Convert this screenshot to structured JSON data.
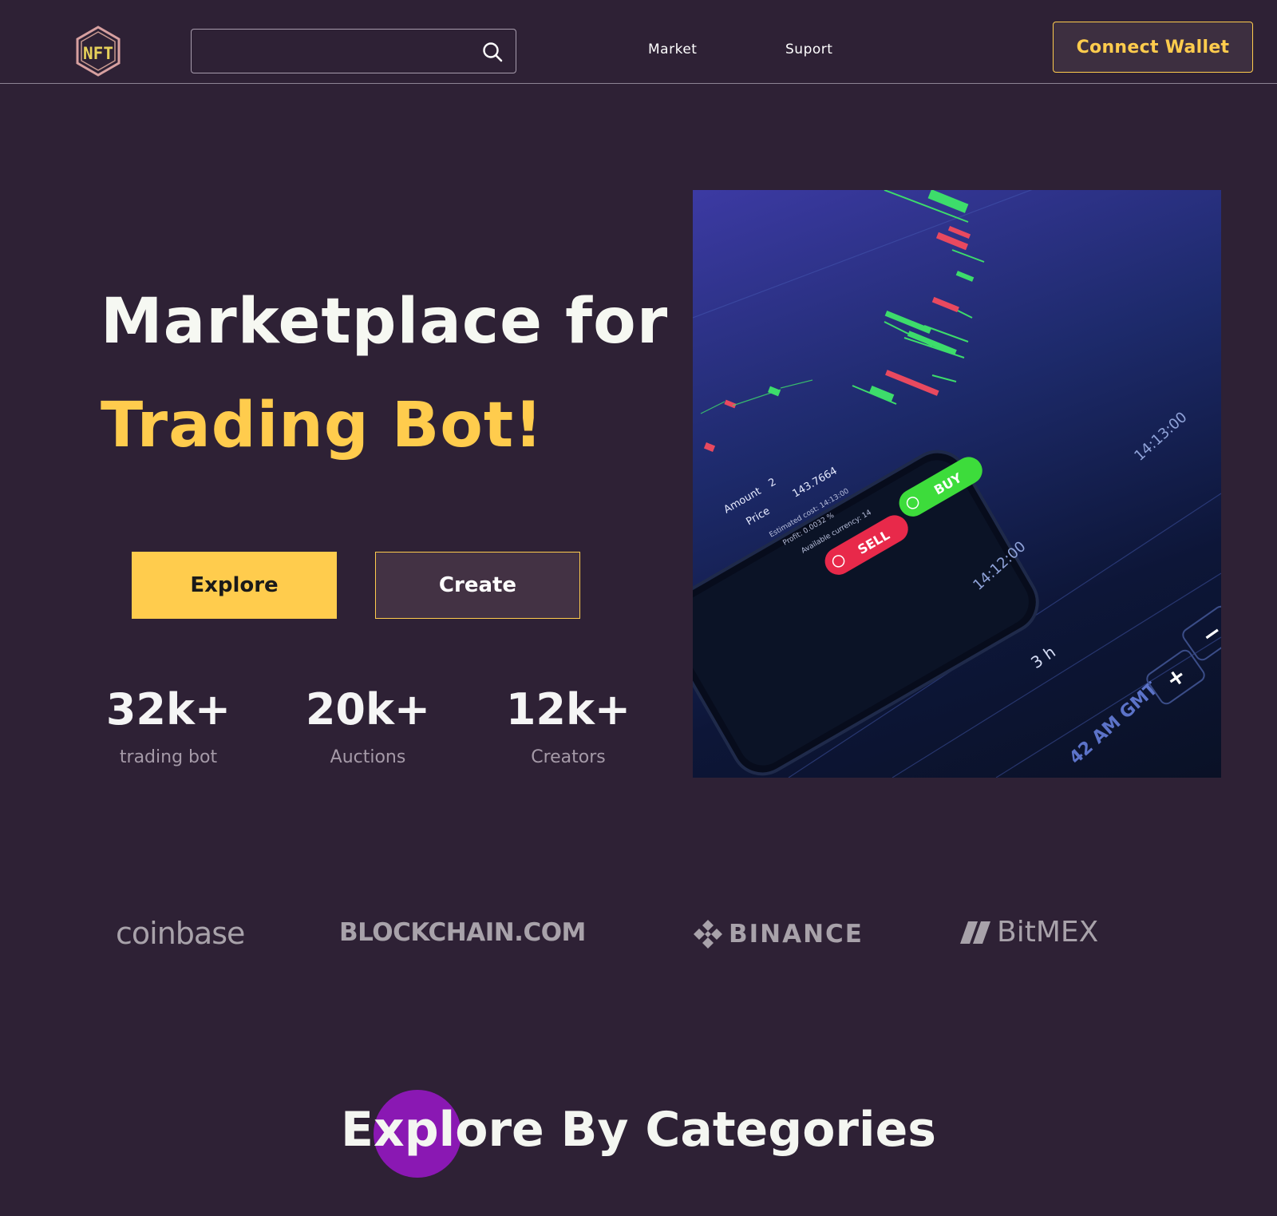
{
  "header": {
    "logo_text": "NFT",
    "search": {
      "placeholder": "",
      "value": "",
      "icon": "search-icon"
    },
    "nav": [
      {
        "label": "Market"
      },
      {
        "label": "Suport"
      }
    ],
    "connect_wallet_label": "Connect Wallet"
  },
  "hero": {
    "title_line1": "Marketplace for",
    "title_line2": "Trading Bot!",
    "explore_label": "Explore",
    "create_label": "Create",
    "stats": [
      {
        "value": "32k+",
        "label": "trading bot"
      },
      {
        "value": "20k+",
        "label": "Auctions"
      },
      {
        "value": "12k+",
        "label": "Creators"
      }
    ],
    "image": {
      "amount_label": "Amount",
      "amount_value": "2",
      "price_label": "Price",
      "price_value": "143.7664",
      "estimated_cost": "Estimated cost: 14:13:00",
      "profit": "Profit: 0.0032 %",
      "available": "Available currency: 14",
      "sell_label": "SELL",
      "buy_label": "BUY",
      "time_1": "14:12:00",
      "time_2": "14:13:00",
      "timeframe": "3 h",
      "clock_label": "42 AM GMT",
      "plus": "+",
      "minus": "−"
    }
  },
  "partners": [
    {
      "name": "coinbase"
    },
    {
      "name": "BLOCKCHAIN.COM"
    },
    {
      "name": "BINANCE"
    },
    {
      "name": "BitMEX"
    }
  ],
  "categories": {
    "title": "Explore By Categories"
  },
  "colors": {
    "background": "#2e2135",
    "accent": "#ffcc4d",
    "deco_circle": "#8a18b3",
    "sell": "#e8294a",
    "buy": "#3ddc3b"
  }
}
